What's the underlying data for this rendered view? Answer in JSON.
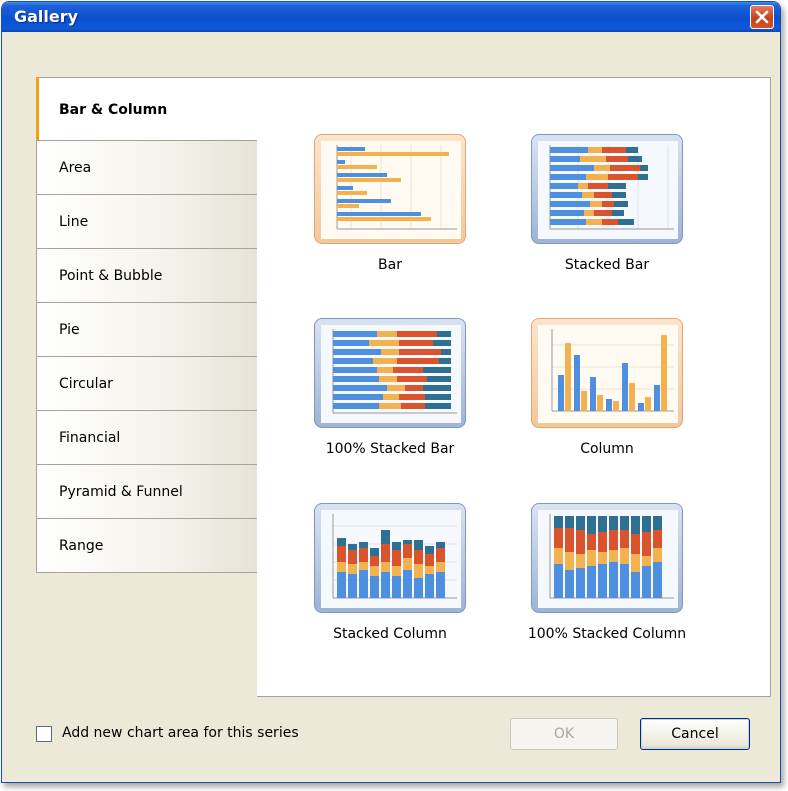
{
  "window": {
    "title": "Gallery"
  },
  "tabs": [
    {
      "label": "Bar & Column",
      "active": true
    },
    {
      "label": "Area"
    },
    {
      "label": "Line"
    },
    {
      "label": "Point & Bubble"
    },
    {
      "label": "Pie"
    },
    {
      "label": "Circular"
    },
    {
      "label": "Financial"
    },
    {
      "label": "Pyramid & Funnel"
    },
    {
      "label": "Range"
    }
  ],
  "gallery": [
    {
      "label": "Bar",
      "style": "warm"
    },
    {
      "label": "Stacked Bar",
      "style": "cool"
    },
    {
      "label": "100% Stacked Bar",
      "style": "cool"
    },
    {
      "label": "Column",
      "style": "warm"
    },
    {
      "label": "Stacked Column",
      "style": "cool"
    },
    {
      "label": "100% Stacked Column",
      "style": "cool"
    }
  ],
  "footer": {
    "checkbox_label": "Add new chart area for this series",
    "checkbox_checked": false,
    "ok_label": "OK",
    "ok_enabled": false,
    "cancel_label": "Cancel"
  },
  "colors": {
    "blue": "#4f8fe0",
    "orange": "#f2b24f",
    "red": "#d9532c",
    "teal": "#2f6f93",
    "accent": "#f2a117"
  }
}
